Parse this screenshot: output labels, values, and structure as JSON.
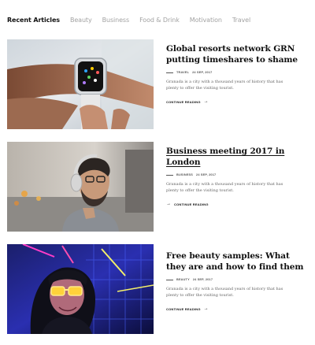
{
  "tabs": [
    {
      "label": "Recent Articles"
    },
    {
      "label": "Beauty"
    },
    {
      "label": "Business"
    },
    {
      "label": "Food & Drink"
    },
    {
      "label": "Motivation"
    },
    {
      "label": "Travel"
    }
  ],
  "articles": [
    {
      "title": "Global resorts network GRN putting timeshares to shame",
      "category": "TRAVEL",
      "date": "24 SEP, 2017",
      "excerpt": "Granada is a city with a thousand years of history that has plenty to offer the visiting tourist.",
      "more": "CONTINUE READING",
      "image": "smartwatch-photo"
    },
    {
      "title": "Business meeting 2017 in London",
      "category": "BUSINESS",
      "date": "24 SEP, 2017",
      "excerpt": "Granada is a city with a thousand years of history that has plenty to offer the visiting tourist.",
      "more": "CONTINUE READING",
      "image": "headphones-man-photo"
    },
    {
      "title": "Free beauty samples: What they are and how to find them",
      "category": "BEAUTY",
      "date": "24 SEP, 2017",
      "excerpt": "Granada is a city with a thousand years of history that has plenty to offer the visiting tourist.",
      "more": "CONTINUE READING",
      "image": "neon-glasses-photo"
    }
  ],
  "colors": {
    "active_tab": "#111111",
    "inactive_tab": "#a3a3a3",
    "excerpt": "#666666"
  }
}
